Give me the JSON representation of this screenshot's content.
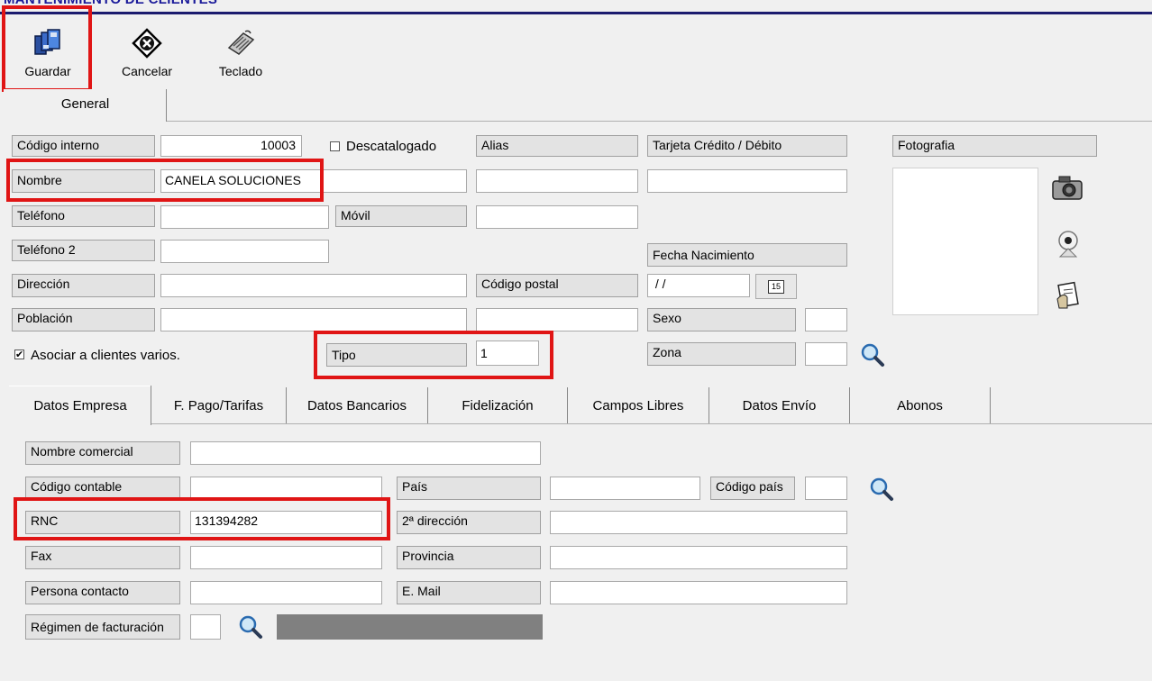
{
  "window": {
    "title": "MANTENIMIENTO DE CLIENTES"
  },
  "toolbar": {
    "save_label": "Guardar",
    "cancel_label": "Cancelar",
    "keyboard_label": "Teclado"
  },
  "top_tabs": {
    "general": "General"
  },
  "general": {
    "codigo_interno_label": "Código interno",
    "codigo_interno_value": "10003",
    "descatalogado_label": "Descatalogado",
    "descatalogado_checked": false,
    "alias_label": "Alias",
    "alias_value": "",
    "tarjeta_label": "Tarjeta Crédito / Débito",
    "tarjeta_value": "",
    "fotografia_label": "Fotografia",
    "nombre_label": "Nombre",
    "nombre_value": "CANELA SOLUCIONES",
    "nombre_extra_value": "",
    "telefono_label": "Teléfono",
    "telefono_value": "",
    "movil_label": "Móvil",
    "movil_value": "",
    "telefono2_label": "Teléfono 2",
    "telefono2_value": "",
    "fecha_nacimiento_label": "Fecha Nacimiento",
    "fecha_nacimiento_value": " / /",
    "calendar_day": "15",
    "direccion_label": "Dirección",
    "direccion_value": "",
    "codigo_postal_label": "Código postal",
    "poblacion_label": "Población",
    "poblacion_value": "",
    "poblacion_extra_value": "",
    "sexo_label": "Sexo",
    "sexo_value": "",
    "asociar_label": "Asociar a clientes varios.",
    "asociar_checked": true,
    "tipo_label": "Tipo",
    "tipo_value": "1",
    "zona_label": "Zona",
    "zona_value": ""
  },
  "sub_tabs": [
    "Datos Empresa",
    "F. Pago/Tarifas",
    "Datos Bancarios",
    "Fidelización",
    "Campos Libres",
    "Datos Envío",
    "Abonos"
  ],
  "empresa": {
    "nombre_comercial_label": "Nombre comercial",
    "nombre_comercial_value": "",
    "codigo_contable_label": "Código contable",
    "codigo_contable_value": "",
    "pais_label": "País",
    "pais_value": "",
    "codigo_pais_label": "Código país",
    "codigo_pais_value": "",
    "rnc_label": "RNC",
    "rnc_value": "131394282",
    "segunda_direccion_label": "2ª dirección",
    "segunda_direccion_value": "",
    "fax_label": "Fax",
    "fax_value": "",
    "provincia_label": "Provincia",
    "provincia_value": "",
    "persona_contacto_label": "Persona contacto",
    "persona_contacto_value": "",
    "email_label": "E. Mail",
    "email_value": "",
    "regimen_label": "Régimen de facturación",
    "regimen_value": "",
    "regimen_desc_value": ""
  },
  "colors": {
    "highlight": "#e01515",
    "title": "#1a1a9a",
    "disabled_field": "#808080"
  }
}
